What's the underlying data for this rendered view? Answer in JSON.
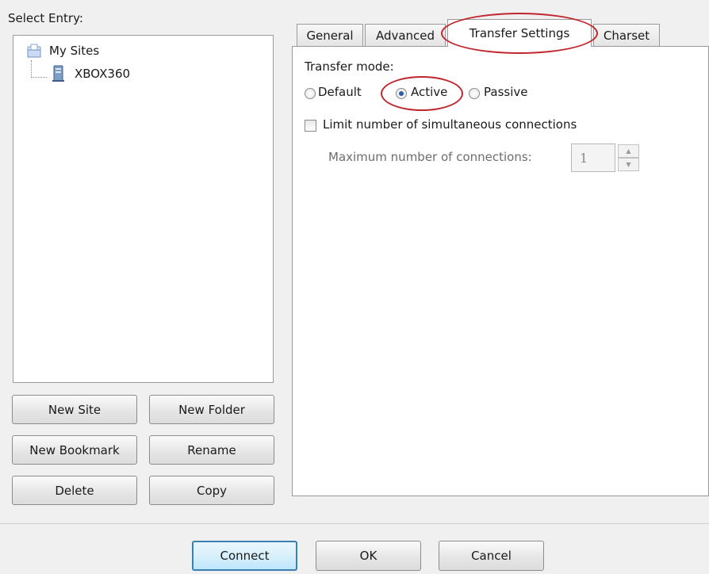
{
  "left": {
    "select_entry_label": "Select Entry:",
    "tree": {
      "root": {
        "label": "My Sites",
        "icon": "folder-icon"
      },
      "child": {
        "label": "XBOX360",
        "icon": "server-icon"
      }
    },
    "buttons": {
      "new_site": "New Site",
      "new_folder": "New Folder",
      "new_bookmark": "New Bookmark",
      "rename": "Rename",
      "delete": "Delete",
      "copy": "Copy"
    }
  },
  "tabs": [
    {
      "label": "General"
    },
    {
      "label": "Advanced"
    },
    {
      "label": "Transfer Settings",
      "active": true
    },
    {
      "label": "Charset"
    }
  ],
  "transfer": {
    "mode_label": "Transfer mode:",
    "options": [
      {
        "label": "Default",
        "checked": false
      },
      {
        "label": "Active",
        "checked": true
      },
      {
        "label": "Passive",
        "checked": false
      }
    ],
    "limit_label": "Limit number of simultaneous connections",
    "limit_checked": false,
    "max_conn_label": "Maximum number of connections:",
    "max_conn_value": "1"
  },
  "footer": {
    "connect": "Connect",
    "ok": "OK",
    "cancel": "Cancel"
  },
  "colors": {
    "annotation": "#c0262d",
    "default_button_border": "#3c7fb1"
  }
}
